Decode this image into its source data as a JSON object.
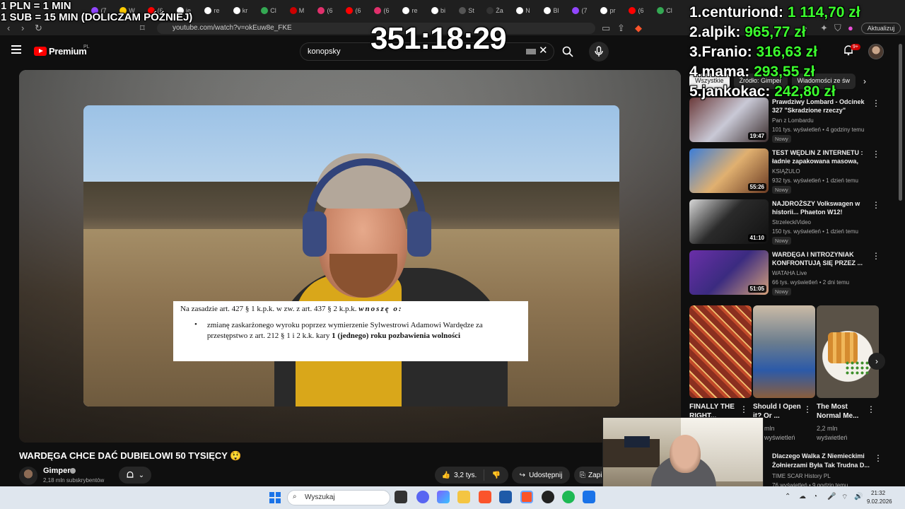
{
  "browser": {
    "tab_count_visible": 30,
    "url": "youtube.com/watch?v=okEuw8e_FKE",
    "update_button": "Aktualizuj",
    "tabs": [
      {
        "label": "(7",
        "color": "#9146ff"
      },
      {
        "label": "W",
        "color": "#ffcc00"
      },
      {
        "label": "(6",
        "color": "#ff0000"
      },
      {
        "label": "je",
        "color": "#ffffff"
      },
      {
        "label": "re",
        "color": "#ffffff"
      },
      {
        "label": "kr",
        "color": "#ffffff"
      },
      {
        "label": "Cl",
        "color": "#34a853"
      },
      {
        "label": "M",
        "color": "#cc0000"
      },
      {
        "label": "(6",
        "color": "#e1306c"
      },
      {
        "label": "(6",
        "color": "#ff0000"
      },
      {
        "label": "(6",
        "color": "#e1306c"
      },
      {
        "label": "re",
        "color": "#ffffff"
      },
      {
        "label": "bi",
        "color": "#ffffff"
      },
      {
        "label": "St",
        "color": "#555555"
      },
      {
        "label": "Ża",
        "color": "#333333"
      },
      {
        "label": "N",
        "color": "#ffffff"
      },
      {
        "label": "Bl",
        "color": "#ffffff"
      },
      {
        "label": "(7",
        "color": "#9146ff"
      },
      {
        "label": "pr",
        "color": "#ffffff"
      },
      {
        "label": "(6",
        "color": "#ff0000"
      },
      {
        "label": "Cl",
        "color": "#34a853"
      }
    ]
  },
  "youtube": {
    "logo_text": "Premium",
    "logo_region": "PL",
    "search_query": "konopsky",
    "notifications_badge": "9+",
    "create_label": "Utwórz"
  },
  "video": {
    "title": "WARDĘGA CHCE DAĆ DUBIELOWI 50 TYSIĘCY 😲",
    "channel": "Gimper",
    "subscribers": "2,18 mln subskrybentów",
    "likes": "3,2 tys.",
    "share_label": "Udostępnij",
    "save_label": "Zapisz",
    "doc_line1_prefix": "Na zasadzie art. 427 § 1 k.p.k. w zw. z art. 437 § 2 k.p.k.",
    "doc_line1_emph": "wnoszę o:",
    "doc_bullet_text": "zmianę zaskarżonego wyroku poprzez wymierzenie Sylwestrowi Adamowi Wardędze za przestępstwo z art. 212 § 1 i 2 k.k. kary",
    "doc_bullet_emph": "1 (jednego) roku pozbawienia wolności"
  },
  "sidebar": {
    "chips": [
      "Wszystkie",
      "Źródło: Gimper",
      "Wiadomości ze św"
    ],
    "recommendations": [
      {
        "title": "Prawdziwy Lombard - Odcinek 327 \"Skradzione rzeczy\"",
        "channel": "Pan z Lombardu",
        "meta": "101 tys. wyświetleń • 4 godziny temu",
        "badge": "Nowy",
        "duration": "19:47"
      },
      {
        "title": "TEST WĘDLIN Z INTERNETU : ładnie zapakowana masowa, ...",
        "channel": "KSIĄŻULO",
        "meta": "932 tys. wyświetleń • 1 dzień temu",
        "badge": "Nowy",
        "duration": "55:26"
      },
      {
        "title": "NAJDROŻSZY Volkswagen w historii... Phaeton W12!",
        "channel": "StrzeleckiVideo",
        "meta": "150 tys. wyświetleń • 1 dzień temu",
        "badge": "Nowy",
        "duration": "41:10"
      },
      {
        "title": "WARDĘGA I NITROZYNIAK KONFRONTUJĄ SIĘ PRZEZ ...",
        "channel": "WATAHA Live",
        "meta": "66 tys. wyświetleń • 2 dni temu",
        "badge": "Nowy",
        "duration": "51:05"
      }
    ],
    "shorts": [
      {
        "title": "FINALLY THE RIGHT...",
        "views": ""
      },
      {
        "title": "Should I Open it? Or ...",
        "views": "mln wyświetleń"
      },
      {
        "title": "The Most Normal Me...",
        "views": "2,2 mln wyświetleń"
      }
    ],
    "rec5": {
      "title": "Dlaczego Walka Z Niemieckimi Żołnierzami Była Tak Trudna D...",
      "channel": "TIME SCAR History PL",
      "meta": "76 wyświetleń • 9 godzin temu"
    }
  },
  "overlay": {
    "rate_line1": "1 PLN = 1 MIN",
    "rate_line2": "1 SUB = 15 MIN (DOLICZAM PÓŹNIEJ)",
    "timer": "351:18:29",
    "leaderboard": [
      {
        "rank": "1.",
        "name": "centuriond:",
        "amount": "1 114,70 zł"
      },
      {
        "rank": "2.",
        "name": "alpik:",
        "amount": "965,77 zł"
      },
      {
        "rank": "3.",
        "name": "Franio:",
        "amount": "316,63 zł"
      },
      {
        "rank": "4.",
        "name": "mama:",
        "amount": "293,55 zł"
      },
      {
        "rank": "5.",
        "name": "jankokac:",
        "amount": "242,80 zł"
      }
    ]
  },
  "taskbar": {
    "search_placeholder": "Wyszukaj",
    "time": "21:32",
    "date": "9.02.2026"
  },
  "colors": {
    "accent_green": "#3cff2e",
    "youtube_red": "#ff0000",
    "bg_dark": "#0f0f0f"
  }
}
